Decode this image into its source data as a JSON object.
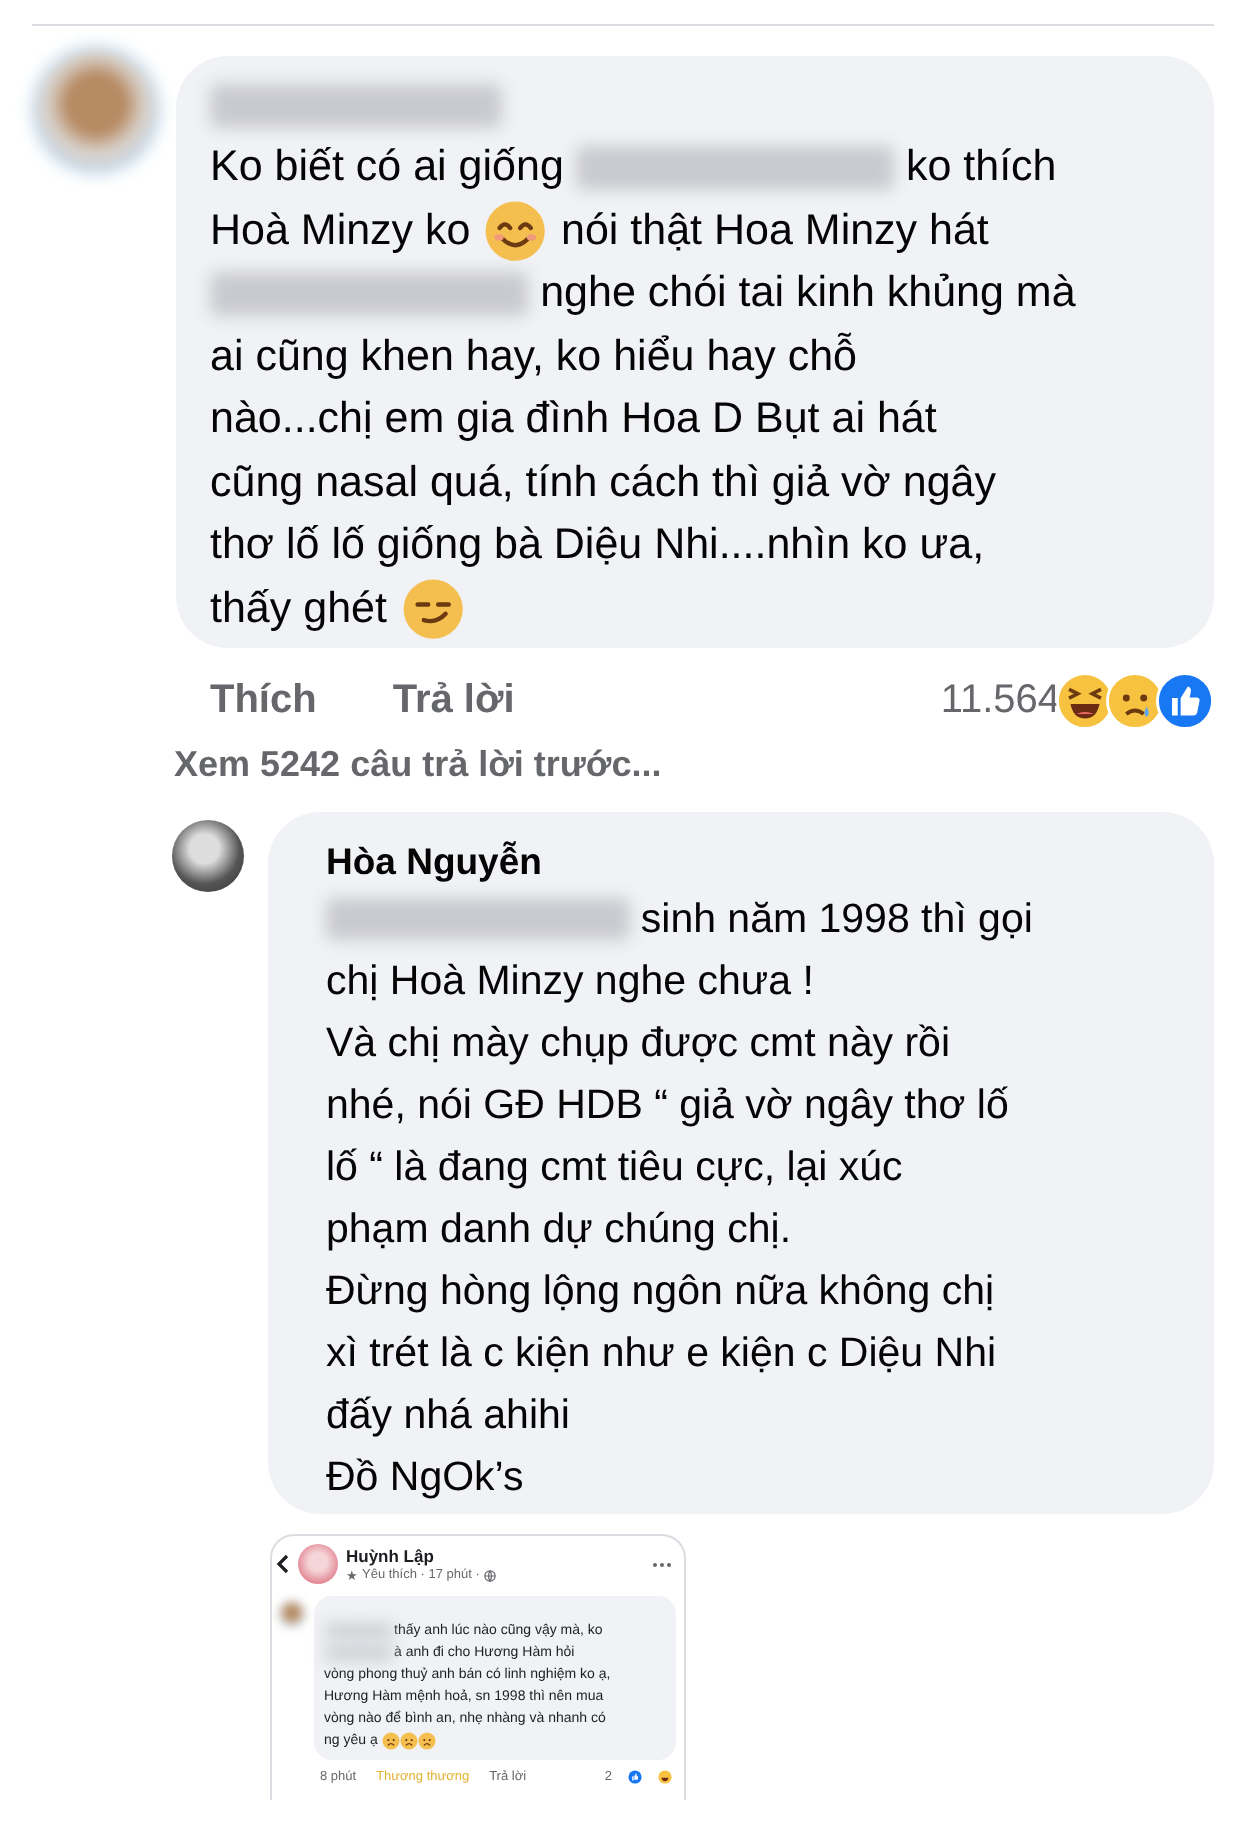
{
  "comment": {
    "avatar": {
      "kind": "blurred"
    },
    "author": {
      "kind": "redacted"
    },
    "lines": [
      [
        {
          "kind": "text",
          "text": "Ko biết có ai giống "
        },
        {
          "kind": "redacted"
        },
        {
          "kind": "text",
          "text": " ko thích"
        }
      ],
      [
        {
          "kind": "text",
          "text": "Hoà Minzy ko "
        },
        {
          "kind": "smile"
        },
        {
          "kind": "text",
          "text": " nói thật Hoa Minzy hát"
        }
      ],
      [
        {
          "kind": "redacted"
        },
        {
          "kind": "text",
          "text": " nghe chói tai kinh khủng mà"
        }
      ],
      [
        {
          "kind": "text",
          "text": "ai cũng khen hay, ko hiểu hay chỗ"
        }
      ],
      [
        {
          "kind": "text",
          "text": "nào...chị em gia đình Hoa D Bụt ai hát"
        }
      ],
      [
        {
          "kind": "text",
          "text": "cũng nasal quá, tính cách thì giả vờ ngây"
        }
      ],
      [
        {
          "kind": "text",
          "text": "thơ lố lố giống bà Diệu Nhi....nhìn ko ưa,"
        }
      ],
      [
        {
          "kind": "text",
          "text": "thấy ghét "
        },
        {
          "kind": "smirk"
        }
      ]
    ],
    "actions": [
      "Thích",
      "Trả lời"
    ],
    "reaction_count": "11.564"
  },
  "more_replies": "Xem 5242 câu trả lời trước...",
  "reply": {
    "avatar": {
      "kind": "plain"
    },
    "author": {
      "kind": "text",
      "text": "Hòa Nguyễn"
    },
    "lines": [
      [
        {
          "kind": "redacted"
        },
        {
          "kind": "text",
          "text": " sinh năm 1998 thì gọi"
        }
      ],
      [
        {
          "kind": "text",
          "text": "chị Hoà Minzy nghe chưa !"
        }
      ],
      [
        {
          "kind": "text",
          "text": "Và chị mày chụp được cmt này rồi"
        }
      ],
      [
        {
          "kind": "text",
          "text": "nhé, nói GĐ HDB “ giả vờ ngây thơ lố"
        }
      ],
      [
        {
          "kind": "text",
          "text": "lố “ là đang cmt tiêu cực, lại xúc"
        }
      ],
      [
        {
          "kind": "text",
          "text": "phạm danh dự chúng chị."
        }
      ],
      [
        {
          "kind": "text",
          "text": "Đừng hòng lộng ngôn nữa không chị"
        }
      ],
      [
        {
          "kind": "text",
          "text": "xì trét là c kiện như e kiện c Diệu Nhi"
        }
      ],
      [
        {
          "kind": "text",
          "text": "đấy nhá ahihi"
        }
      ],
      [
        {
          "kind": "text",
          "text": "Đồ NgOk’s"
        }
      ]
    ],
    "attachment": {
      "avatar": {
        "kind": "plain"
      },
      "author": "Huỳnh Lập",
      "badge": "★",
      "meta": "Yêu thích · 17 phút ·",
      "comment": {
        "avatar": {
          "kind": "blurred"
        },
        "lines": [
          [
            {
              "kind": "redacted"
            },
            {
              "kind": "text",
              "text": "thấy anh lúc nào cũng vậy mà, ko"
            }
          ],
          [
            {
              "kind": "redacted"
            },
            {
              "kind": "text",
              "text": "à anh đi cho Hương Hàm hỏi"
            }
          ],
          [
            {
              "kind": "text",
              "text": "vòng phong thuỷ anh bán có linh nghiệm ko ạ,"
            }
          ],
          [
            {
              "kind": "text",
              "text": "Hương Hàm mệnh hoả, sn 1998 thì nên mua"
            }
          ],
          [
            {
              "kind": "text",
              "text": "vòng nào để bình an, nhẹ nhàng và nhanh có"
            }
          ],
          [
            {
              "kind": "text",
              "text": "ng yêu ạ "
            },
            {
              "kind": "sad"
            },
            {
              "kind": "sad"
            },
            {
              "kind": "sad"
            }
          ]
        ]
      },
      "footer": {
        "time": "8 phút",
        "reaction": "Thương thương",
        "reply": "Trả lời",
        "count": "2"
      }
    }
  }
}
